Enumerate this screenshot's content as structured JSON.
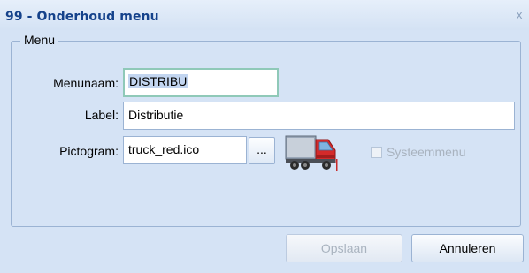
{
  "window": {
    "title": "99 - Onderhoud menu",
    "close_icon": "close-icon"
  },
  "group": {
    "legend": "Menu"
  },
  "fields": {
    "menunaam": {
      "label": "Menunaam:",
      "value": "DISTRIBU"
    },
    "label": {
      "label": "Label:",
      "value": "Distributie"
    },
    "pictogram": {
      "label": "Pictogram:",
      "value": "truck_red.ico",
      "browse_label": "...",
      "icon": "truck-icon"
    }
  },
  "systeemmenu": {
    "label": "Systeemmenu",
    "checked": false,
    "enabled": false
  },
  "buttons": {
    "save": "Opslaan",
    "cancel": "Annuleren"
  },
  "colors": {
    "title": "#15428b",
    "background": "#d5e3f5",
    "truck": "#d42a2a"
  }
}
